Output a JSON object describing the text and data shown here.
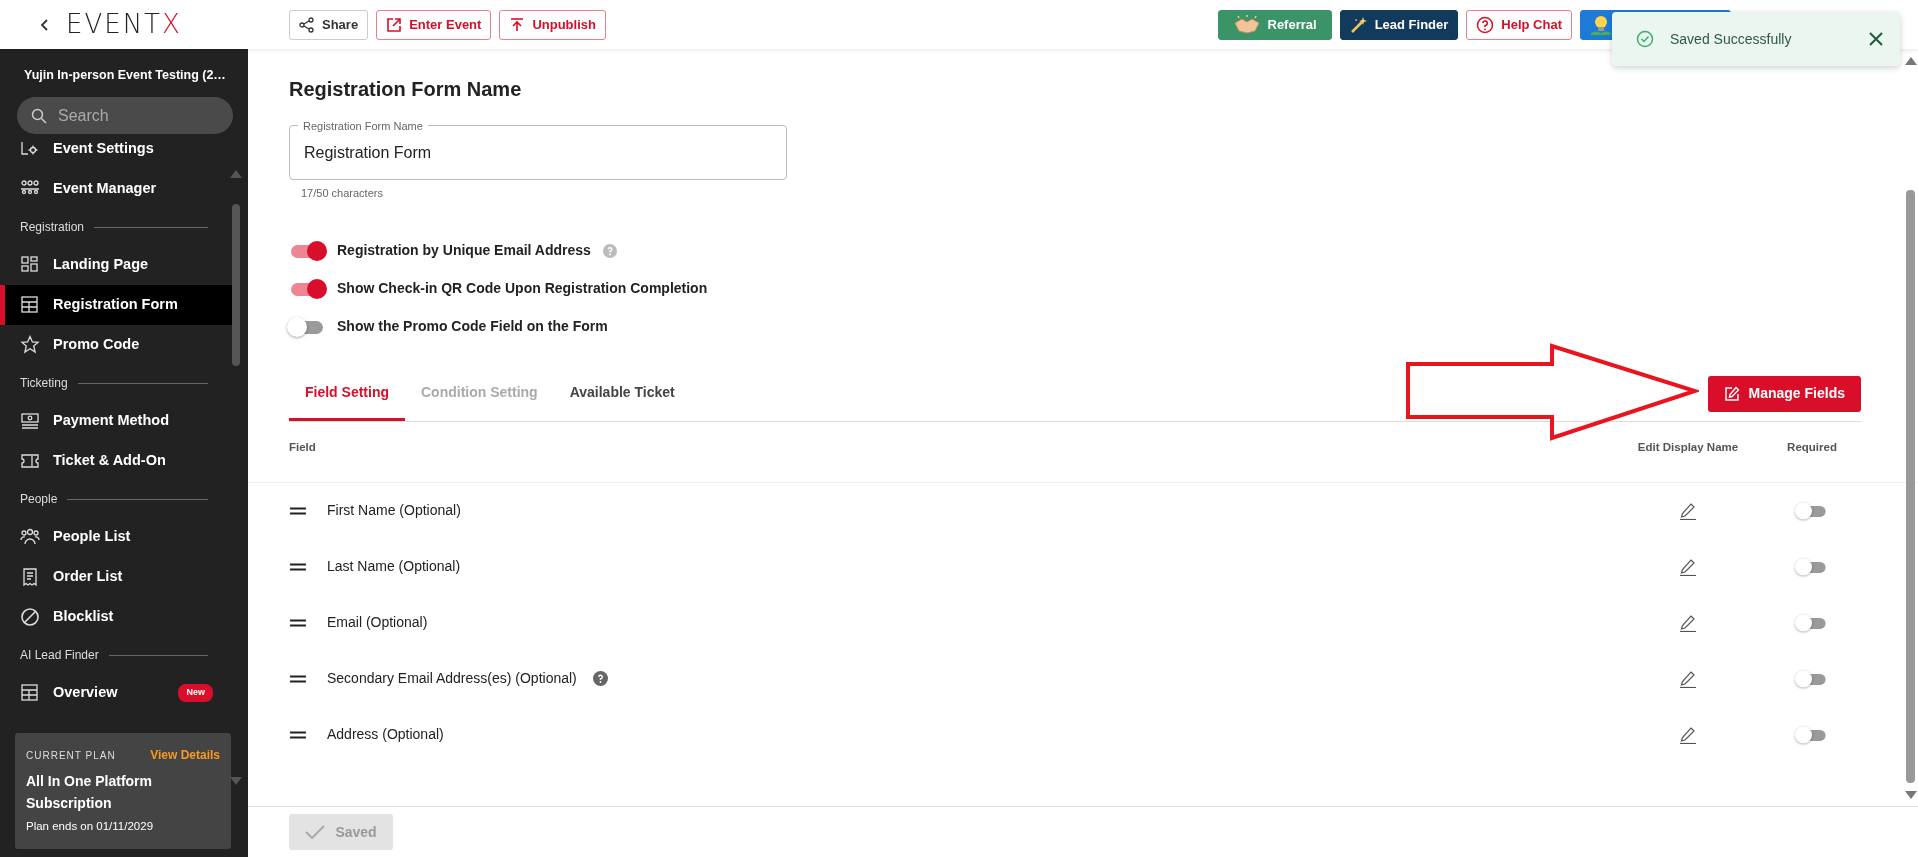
{
  "topbar": {
    "logo": {
      "text": "EVENT",
      "accent": "X"
    },
    "left_buttons": [
      {
        "label": "Share",
        "kind": "plain"
      },
      {
        "label": "Enter Event",
        "kind": "danger"
      },
      {
        "label": "Unpublish",
        "kind": "danger"
      }
    ],
    "right_buttons": [
      {
        "label": "Referral",
        "kind": "green"
      },
      {
        "label": "Lead Finder",
        "kind": "navy"
      },
      {
        "label": "Help Chat",
        "kind": "danger"
      },
      {
        "kind": "blue"
      }
    ]
  },
  "toast": {
    "message": "Saved Successfully"
  },
  "sidebar": {
    "event_title": "Yujin In-person Event Testing (2…",
    "search": {
      "placeholder": "Search"
    },
    "items": [
      {
        "kind": "item",
        "label": "Event Settings",
        "selected": false
      },
      {
        "kind": "item",
        "label": "Event Manager",
        "selected": false
      },
      {
        "kind": "section",
        "label": "Registration"
      },
      {
        "kind": "item",
        "label": "Landing Page",
        "selected": false
      },
      {
        "kind": "item",
        "label": "Registration Form",
        "selected": true
      },
      {
        "kind": "item",
        "label": "Promo Code",
        "selected": false
      },
      {
        "kind": "section",
        "label": "Ticketing"
      },
      {
        "kind": "item",
        "label": "Payment Method",
        "selected": false
      },
      {
        "kind": "item",
        "label": "Ticket & Add-On",
        "selected": false
      },
      {
        "kind": "section",
        "label": "People"
      },
      {
        "kind": "item",
        "label": "People List",
        "selected": false
      },
      {
        "kind": "item",
        "label": "Order List",
        "selected": false
      },
      {
        "kind": "item",
        "label": "Blocklist",
        "selected": false
      },
      {
        "kind": "section",
        "label": "AI Lead Finder"
      },
      {
        "kind": "item",
        "label": "Overview",
        "selected": false,
        "badge": "New"
      }
    ],
    "plan": {
      "caption": "CURRENT PLAN",
      "link": "View Details",
      "name": "All In One Platform Subscription",
      "expiry": "Plan ends on 01/11/2029"
    }
  },
  "form": {
    "title": "Registration Form Name",
    "name_field": {
      "label": "Registration Form Name",
      "value": "Registration Form",
      "counter": "17/50 characters"
    },
    "toggles": [
      {
        "label": "Registration by Unique Email Address",
        "on": true,
        "help": true
      },
      {
        "label": "Show Check-in QR Code Upon Registration Completion",
        "on": true,
        "help": false
      },
      {
        "label": "Show the Promo Code Field on the Form",
        "on": false,
        "help": false
      }
    ],
    "tabs": [
      {
        "label": "Field Setting",
        "selected": true,
        "disabled": false
      },
      {
        "label": "Condition Setting",
        "selected": false,
        "disabled": true
      },
      {
        "label": "Available Ticket",
        "selected": false,
        "disabled": false
      }
    ],
    "manage_button": "Manage Fields",
    "table": {
      "columns": [
        "Field",
        "Edit Display Name",
        "Required"
      ],
      "rows": [
        {
          "field": "First Name (Optional)",
          "required": false,
          "help": false
        },
        {
          "field": "Last Name (Optional)",
          "required": false,
          "help": false
        },
        {
          "field": "Email (Optional)",
          "required": false,
          "help": false
        },
        {
          "field": "Secondary Email Address(es) (Optional)",
          "required": false,
          "help": true
        },
        {
          "field": "Address (Optional)",
          "required": false,
          "help": false
        }
      ]
    },
    "save_button": {
      "label": "Saved",
      "disabled": true
    }
  }
}
